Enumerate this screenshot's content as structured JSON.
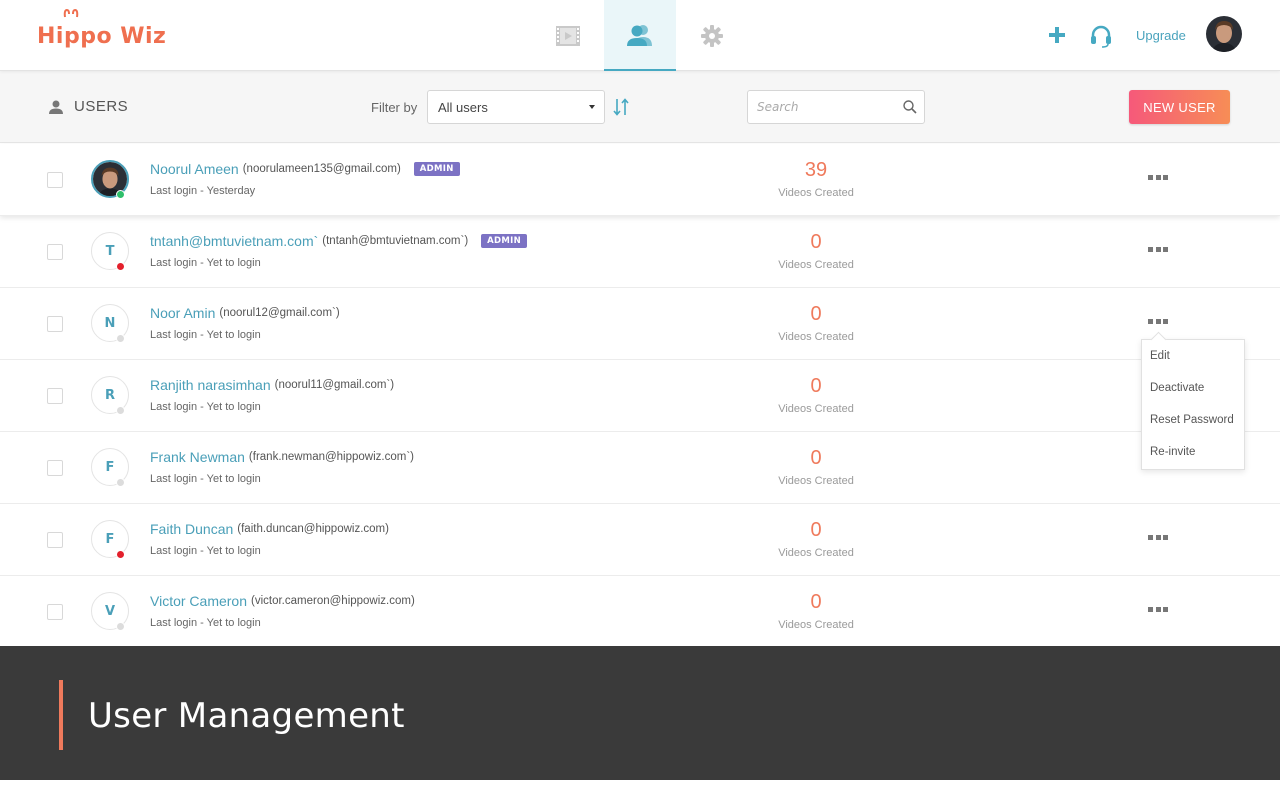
{
  "app": {
    "logo_text": "Hippo Wiz"
  },
  "nav": {
    "tabs": [
      {
        "name": "videos",
        "icon": "film-icon",
        "active": false
      },
      {
        "name": "users",
        "icon": "users-icon",
        "active": true
      },
      {
        "name": "settings",
        "icon": "gear-icon",
        "active": false
      }
    ],
    "upgrade_label": "Upgrade"
  },
  "toolbar": {
    "title": "USERS",
    "filter_label": "Filter by",
    "filter_value": "All users",
    "search_placeholder": "Search",
    "new_user_label": "NEW USER"
  },
  "users": [
    {
      "name": "Noorul Ameen",
      "email": "(noorulameen135@gmail.com)",
      "role": "ADMIN",
      "last_login": "Last login - Yesterday",
      "videos": "39",
      "videos_label": "Videos Created",
      "avatar_initial": "",
      "status": "online"
    },
    {
      "name": "tntanh@bmtuvietnam.com`",
      "email": "(tntanh@bmtuvietnam.com`)",
      "role": "ADMIN",
      "last_login": "Last login - Yet to login",
      "videos": "0",
      "videos_label": "Videos Created",
      "avatar_initial": "T",
      "status": "offline"
    },
    {
      "name": "Noor Amin",
      "email": "(noorul12@gmail.com`)",
      "role": "",
      "last_login": "Last login - Yet to login",
      "videos": "0",
      "videos_label": "Videos Created",
      "avatar_initial": "N",
      "status": "inactive"
    },
    {
      "name": "Ranjith narasimhan",
      "email": "(noorul11@gmail.com`)",
      "role": "",
      "last_login": "Last login - Yet to login",
      "videos": "0",
      "videos_label": "Videos Created",
      "avatar_initial": "R",
      "status": "inactive"
    },
    {
      "name": "Frank Newman",
      "email": "(frank.newman@hippowiz.com`)",
      "role": "",
      "last_login": "Last login - Yet to login",
      "videos": "0",
      "videos_label": "Videos Created",
      "avatar_initial": "F",
      "status": "inactive"
    },
    {
      "name": "Faith Duncan",
      "email": "(faith.duncan@hippowiz.com)",
      "role": "",
      "last_login": "Last login - Yet to login",
      "videos": "0",
      "videos_label": "Videos Created",
      "avatar_initial": "F",
      "status": "offline"
    },
    {
      "name": "Victor Cameron",
      "email": "(victor.cameron@hippowiz.com)",
      "role": "",
      "last_login": "Last login - Yet to login",
      "videos": "0",
      "videos_label": "Videos Created",
      "avatar_initial": "V",
      "status": "inactive"
    }
  ],
  "context_menu": {
    "items": [
      "Edit",
      "Deactivate",
      "Reset Password",
      "Re-invite"
    ]
  },
  "caption": {
    "title": "User Management"
  },
  "colors": {
    "accent_teal": "#4a9fb8",
    "accent_coral": "#ef7a5c",
    "admin_badge": "#7c72c4",
    "online": "#2fbf6b",
    "offline": "#e3202c"
  }
}
